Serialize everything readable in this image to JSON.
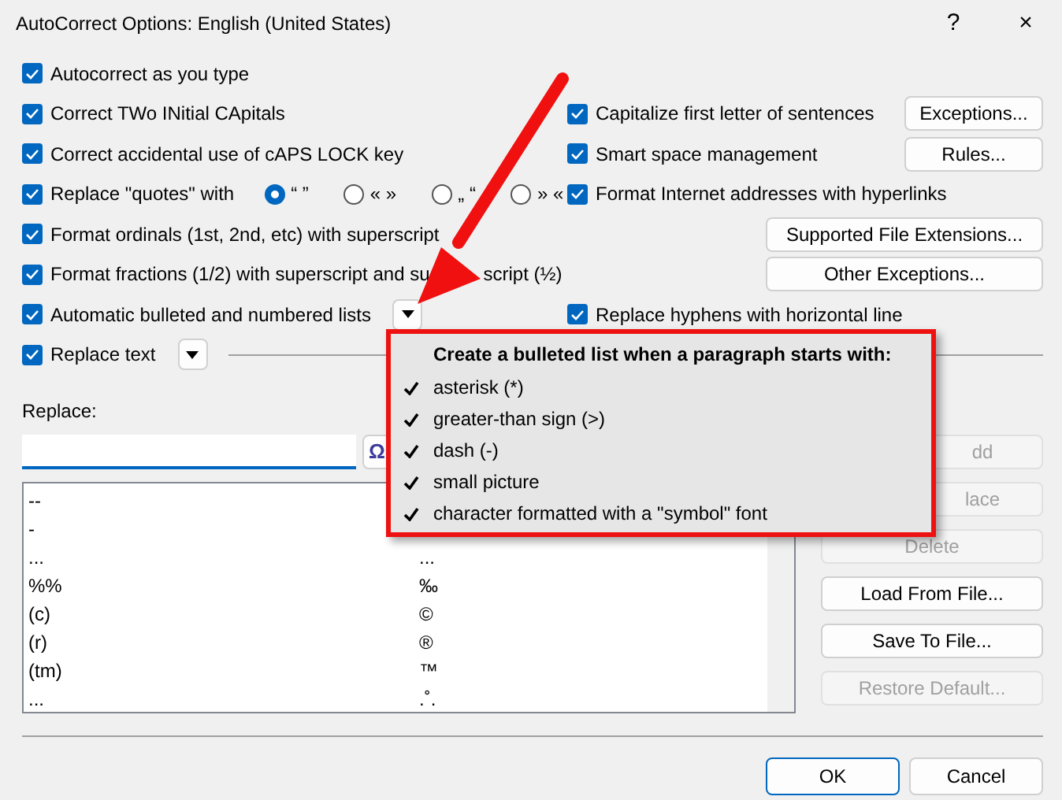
{
  "window": {
    "title": "AutoCorrect Options: English (United States)",
    "help": "?",
    "close": "×"
  },
  "left_options": [
    {
      "kind": "checkbox",
      "label": "Autocorrect as you type",
      "checked": true
    },
    {
      "kind": "checkbox",
      "label": "Correct TWo INitial CApitals",
      "checked": true
    },
    {
      "kind": "checkbox",
      "label": "Correct accidental use of cAPS LOCK key",
      "checked": true
    },
    {
      "kind": "quotes",
      "label": "Replace \"quotes\" with",
      "checked": true,
      "choices": [
        {
          "label": "“ ”",
          "selected": true
        },
        {
          "label": "« »",
          "selected": false
        },
        {
          "label": "„ “",
          "selected": false
        },
        {
          "label": "» «",
          "selected": false
        }
      ]
    },
    {
      "kind": "checkbox",
      "label": "Format ordinals (1st, 2nd, etc) with superscript",
      "checked": true
    },
    {
      "kind": "checkbox",
      "label": [
        "Format fractions (1/2) with superscript and su",
        "script (½)"
      ],
      "checked": true
    },
    {
      "kind": "dropdown",
      "label": "Automatic bulleted and numbered lists",
      "checked": true
    }
  ],
  "right_options": [
    {
      "kind": "checkbox",
      "label": "Capitalize first letter of sentences",
      "checked": true,
      "button": "Exceptions..."
    },
    {
      "kind": "checkbox",
      "label": "Smart space management",
      "checked": true,
      "button": "Rules..."
    },
    {
      "kind": "checkbox",
      "label": "Format Internet addresses with hyperlinks",
      "checked": true
    },
    {
      "kind": "button",
      "button": "Supported File Extensions..."
    },
    {
      "kind": "button",
      "button": "Other Exceptions..."
    },
    {
      "kind": "checkbox",
      "label": "Replace hyphens with horizontal line",
      "checked": true
    }
  ],
  "replace_text": {
    "label": "Replace text",
    "checked": true
  },
  "replace": {
    "label": "Replace:",
    "symbol": "Ω"
  },
  "table": {
    "rows": [
      {
        "replace": "--"
      },
      {
        "replace": "-"
      },
      {
        "replace": "...",
        "with": "..."
      },
      {
        "replace": "%%",
        "with": "‰"
      },
      {
        "replace": "(c)",
        "with": "©"
      },
      {
        "replace": "(r)",
        "with": "®"
      },
      {
        "replace": "(tm)",
        "with": "™"
      },
      {
        "replace": "...",
        "with": ".˚."
      }
    ]
  },
  "side_buttons": [
    {
      "label": "dd",
      "disabled": true,
      "covered": true
    },
    {
      "label": "lace",
      "disabled": true,
      "covered": true
    },
    {
      "label": "Delete",
      "disabled": true,
      "covered": false
    },
    {
      "label": "Load From File...",
      "disabled": false,
      "covered": false
    },
    {
      "label": "Save To File...",
      "disabled": false,
      "covered": false
    },
    {
      "label": "Restore Default...",
      "disabled": true,
      "covered": false
    }
  ],
  "popup": {
    "title": "Create a bulleted list when a paragraph starts with:",
    "items": [
      {
        "label": "asterisk (*)",
        "checked": true
      },
      {
        "label": "greater-than sign (>)",
        "checked": true
      },
      {
        "label": "dash (-)",
        "checked": true
      },
      {
        "label": "small picture",
        "checked": true
      },
      {
        "label": "character formatted with a \"symbol\" font",
        "checked": true
      }
    ]
  },
  "footer": [
    {
      "label": "OK",
      "default": true
    },
    {
      "label": "Cancel",
      "default": false
    }
  ]
}
